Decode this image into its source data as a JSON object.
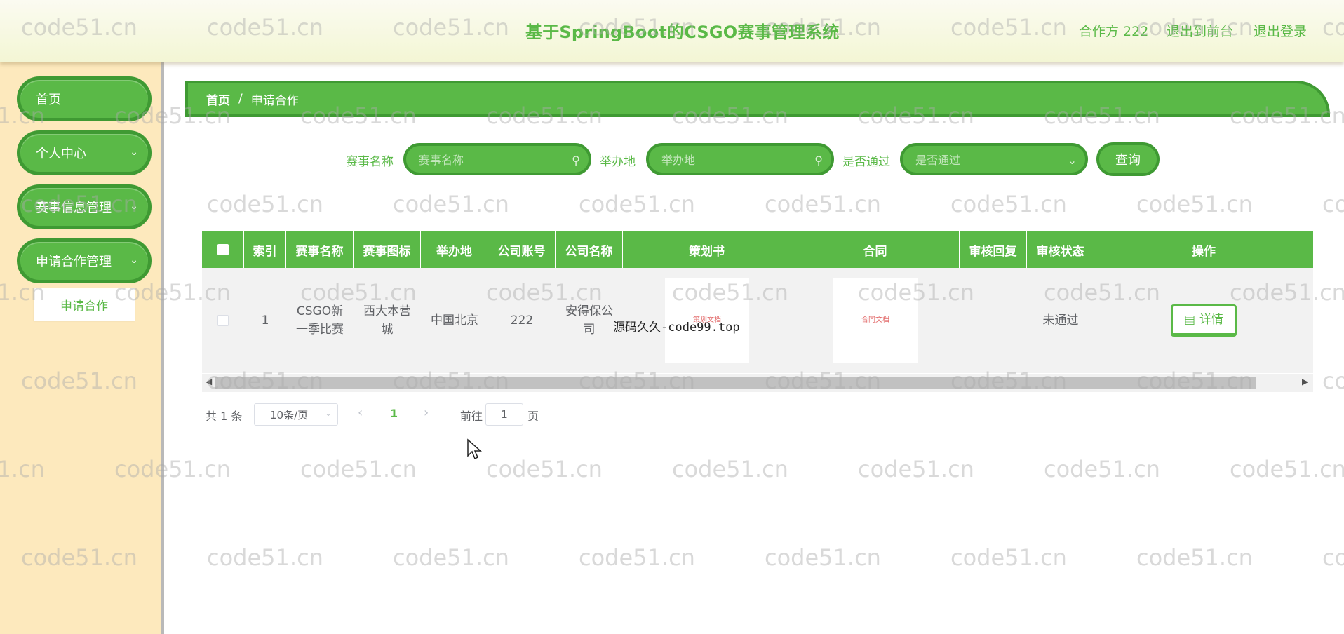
{
  "header": {
    "title": "基于SpringBoot的CSGO赛事管理系统",
    "user_label": "合作方 222",
    "back_to_front": "退出到前台",
    "logout": "退出登录"
  },
  "sidebar": {
    "items": [
      {
        "label": "首页",
        "has_children": false
      },
      {
        "label": "个人中心",
        "has_children": true
      },
      {
        "label": "赛事信息管理",
        "has_children": true
      },
      {
        "label": "申请合作管理",
        "has_children": true
      }
    ],
    "submenu": {
      "label": "申请合作"
    }
  },
  "breadcrumb": {
    "home": "首页",
    "separator": "/",
    "current": "申请合作"
  },
  "search": {
    "event_name_label": "赛事名称",
    "event_name_placeholder": "赛事名称",
    "venue_label": "举办地",
    "venue_placeholder": "举办地",
    "passed_label": "是否通过",
    "passed_placeholder": "是否通过",
    "query_button": "查询"
  },
  "table": {
    "columns": [
      "索引",
      "赛事名称",
      "赛事图标",
      "举办地",
      "公司账号",
      "公司名称",
      "策划书",
      "合同",
      "审核回复",
      "审核状态",
      "操作"
    ],
    "rows": [
      {
        "index": "1",
        "event_name": "CSGO新一季比赛",
        "event_icon": "西大本营城",
        "venue": "中国北京",
        "company_account": "222",
        "company_name": "安得保公司",
        "plan_doc": "策划文档",
        "contract_doc": "合同文档",
        "review_reply": "",
        "review_status": "未通过",
        "action": "详情"
      }
    ]
  },
  "overlay_text": "源码久久-code99.top",
  "pagination": {
    "total": "共 1 条",
    "page_size": "10条/页",
    "current_page": "1",
    "goto_prefix": "前往",
    "goto_value": "1",
    "goto_suffix": "页"
  },
  "watermark": "code51.cn",
  "colors": {
    "primary": "#5ab947",
    "primary_dark": "#3f9a33",
    "sidebar_bg": "#fde9bd",
    "header_bg": "#f3f6d4"
  }
}
